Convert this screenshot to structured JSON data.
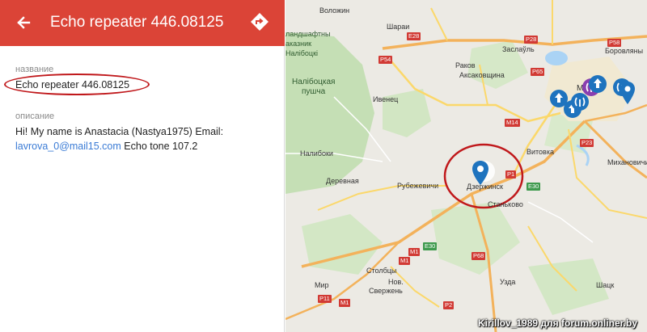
{
  "header": {
    "title": "Echo repeater 446.08125",
    "color": "#db4437"
  },
  "details": {
    "name_label": "название",
    "name_value": "Echo repeater 446.08125",
    "desc_label": "описание",
    "desc_line1": "Hi! My name is Anastacia (Nastya1975)  Email:",
    "desc_email": "lavrova_0@mail15.com",
    "desc_tail": " Echo tone 107.2"
  },
  "map": {
    "places": {
      "volozhin": "Воложин",
      "sharai": "Шараи",
      "nalib_line1": "ландшафтны",
      "nalib_line2": "аказник",
      "nalib_line3": "Налібоцкі",
      "zaslavl": "Заслаўль",
      "borovlyany": "Боровляны",
      "rakov": "Раков",
      "aksakovshchina": "Аксаковщина",
      "nalib_pushcha1": "Налібоцкая",
      "nalib_pushcha2": "пушча",
      "ivenets": "Ивенец",
      "minsk": "Минск",
      "vitovka": "Витовка",
      "nalibaki": "Налибоки",
      "mikhanovichi": "Михановичи",
      "rubezhevichi": "Рубежевичи",
      "dzerzhinsk": "Дзержинск",
      "derevnaya": "Деревная",
      "stankovo": "Станьково",
      "stolbtsy": "Столбцы",
      "nov_sverzhen1": "Нов.",
      "nov_sverzhen2": "Свержень",
      "mir": "Мир",
      "uzda": "Узда",
      "shatsk": "Шацк"
    },
    "roads": {
      "e28": "E28",
      "p28": "P28",
      "p58": "P58",
      "p54": "P54",
      "p65": "P65",
      "m14": "M14",
      "p23": "P23",
      "p1": "P1",
      "e30a": "E30",
      "e30b": "E30",
      "m1": "M1",
      "p68": "P68",
      "p2": "P2",
      "p11": "P11",
      "m1b": "M1",
      "m1c": "M1"
    },
    "watermark": "Kirillov_1989 для forum.onliner.by",
    "pin_color": "#1e73be",
    "highlight_color": "#c0181b"
  }
}
